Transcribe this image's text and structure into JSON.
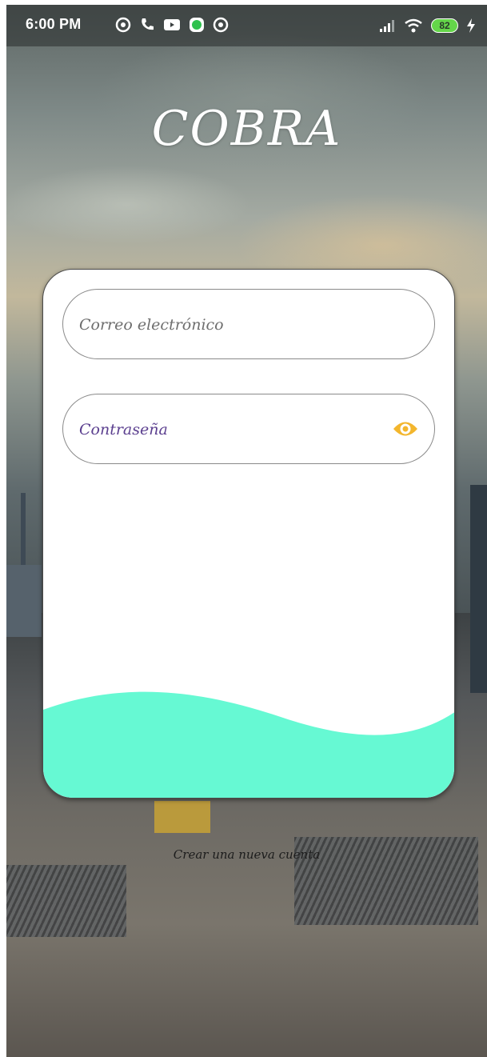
{
  "status_bar": {
    "time": "6:00 PM",
    "battery": "82",
    "left_icons": [
      "at-sign-icon",
      "phone-icon",
      "youtube-icon",
      "green-dot-icon",
      "at-sign-icon"
    ],
    "right_icons": [
      "signal-icon",
      "wifi-icon",
      "battery-icon",
      "charging-icon"
    ]
  },
  "app": {
    "title": "COBRA"
  },
  "login": {
    "email_placeholder": "Correo electrónico",
    "password_placeholder": "Contraseña",
    "eye_icon": "eye-icon",
    "eye_color": "#f3b62d"
  },
  "footer": {
    "create_account": "Crear una nueva cuenta"
  },
  "colors": {
    "wave": "#66f9d3",
    "card": "#ffffff",
    "password_placeholder": "#5b3f8f"
  }
}
